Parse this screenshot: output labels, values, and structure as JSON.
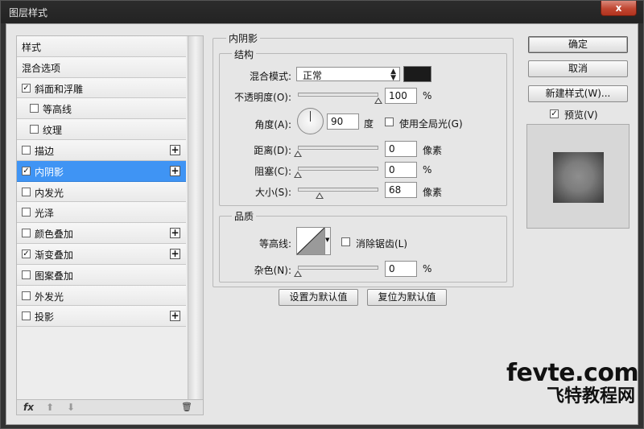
{
  "window": {
    "title": "图层样式",
    "close_glyph": "x"
  },
  "style_list": {
    "items": [
      {
        "label": "样式",
        "checkbox": false,
        "checked": false,
        "plus": false,
        "indent": false,
        "active": false
      },
      {
        "label": "混合选项",
        "checkbox": false,
        "checked": false,
        "plus": false,
        "indent": false,
        "active": false
      },
      {
        "label": "斜面和浮雕",
        "checkbox": true,
        "checked": true,
        "plus": false,
        "indent": false,
        "active": false
      },
      {
        "label": "等高线",
        "checkbox": true,
        "checked": false,
        "plus": false,
        "indent": true,
        "active": false
      },
      {
        "label": "纹理",
        "checkbox": true,
        "checked": false,
        "plus": false,
        "indent": true,
        "active": false
      },
      {
        "label": "描边",
        "checkbox": true,
        "checked": false,
        "plus": true,
        "indent": false,
        "active": false
      },
      {
        "label": "内阴影",
        "checkbox": true,
        "checked": true,
        "plus": true,
        "indent": false,
        "active": true
      },
      {
        "label": "内发光",
        "checkbox": true,
        "checked": false,
        "plus": false,
        "indent": false,
        "active": false
      },
      {
        "label": "光泽",
        "checkbox": true,
        "checked": false,
        "plus": false,
        "indent": false,
        "active": false
      },
      {
        "label": "颜色叠加",
        "checkbox": true,
        "checked": false,
        "plus": true,
        "indent": false,
        "active": false
      },
      {
        "label": "渐变叠加",
        "checkbox": true,
        "checked": true,
        "plus": true,
        "indent": false,
        "active": false
      },
      {
        "label": "图案叠加",
        "checkbox": true,
        "checked": false,
        "plus": false,
        "indent": false,
        "active": false
      },
      {
        "label": "外发光",
        "checkbox": true,
        "checked": false,
        "plus": false,
        "indent": false,
        "active": false
      },
      {
        "label": "投影",
        "checkbox": true,
        "checked": false,
        "plus": true,
        "indent": false,
        "active": false
      }
    ],
    "footer": {
      "fx": "fx",
      "up": "⬆",
      "down": "⬇",
      "trash": "🗑"
    }
  },
  "inner_shadow": {
    "section_title": "内阴影",
    "structure": {
      "title": "结构",
      "blend_mode_label": "混合模式:",
      "blend_mode_value": "正常",
      "swatch_color": "#1b1b1b",
      "opacity_label": "不透明度(O):",
      "opacity_value": "100",
      "opacity_unit": "%",
      "opacity_level": 1.0,
      "angle_label": "角度(A):",
      "angle_value": "90",
      "angle_unit": "度",
      "global_light_label": "使用全局光(G)",
      "global_light_checked": false,
      "distance_label": "距离(D):",
      "distance_value": "0",
      "distance_unit": "像素",
      "distance_level": 0.0,
      "choke_label": "阻塞(C):",
      "choke_value": "0",
      "choke_unit": "%",
      "choke_level": 0.0,
      "size_label": "大小(S):",
      "size_value": "68",
      "size_unit": "像素",
      "size_level": 0.27
    },
    "quality": {
      "title": "品质",
      "contour_label": "等高线:",
      "anti_alias_label": "消除锯齿(L)",
      "anti_alias_checked": false,
      "noise_label": "杂色(N):",
      "noise_value": "0",
      "noise_unit": "%",
      "noise_level": 0.0
    },
    "make_default_label": "设置为默认值",
    "reset_default_label": "复位为默认值"
  },
  "actions": {
    "ok_label": "确定",
    "cancel_label": "取消",
    "new_style_label": "新建样式(W)...",
    "preview_label": "预览(V)",
    "preview_checked": true
  },
  "watermark": {
    "line1": "fevte.com",
    "line2": "飞特教程网"
  }
}
